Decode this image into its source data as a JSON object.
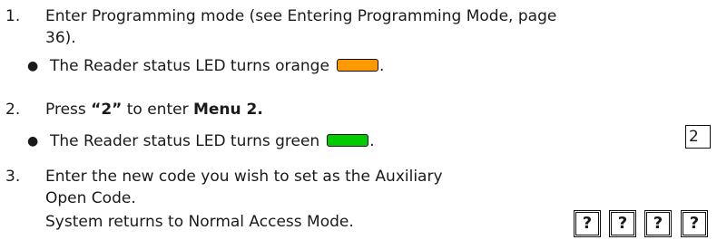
{
  "steps": [
    {
      "number": "1.",
      "line1": "Enter Programming mode (see Entering Programming Mode, page",
      "line2": "36).",
      "bullet": "The Reader status LED turns orange",
      "bullet_end": "."
    },
    {
      "number": "2.",
      "pre": "Press ",
      "key": "“2”",
      "mid": " to enter ",
      "menu": "Menu 2.",
      "bullet": "The Reader status LED turns green",
      "bullet_end": "."
    },
    {
      "number": "3.",
      "line1": "Enter the new code you wish to set as the Auxiliary",
      "line2": "Open Code.",
      "line3": "System returns to Normal Access Mode."
    }
  ],
  "keypad": {
    "menu_key": "2",
    "code_keys": [
      "?",
      "?",
      "?",
      "?"
    ]
  },
  "colors": {
    "orange_led": "#FF9900",
    "green_led": "#00CC00"
  }
}
